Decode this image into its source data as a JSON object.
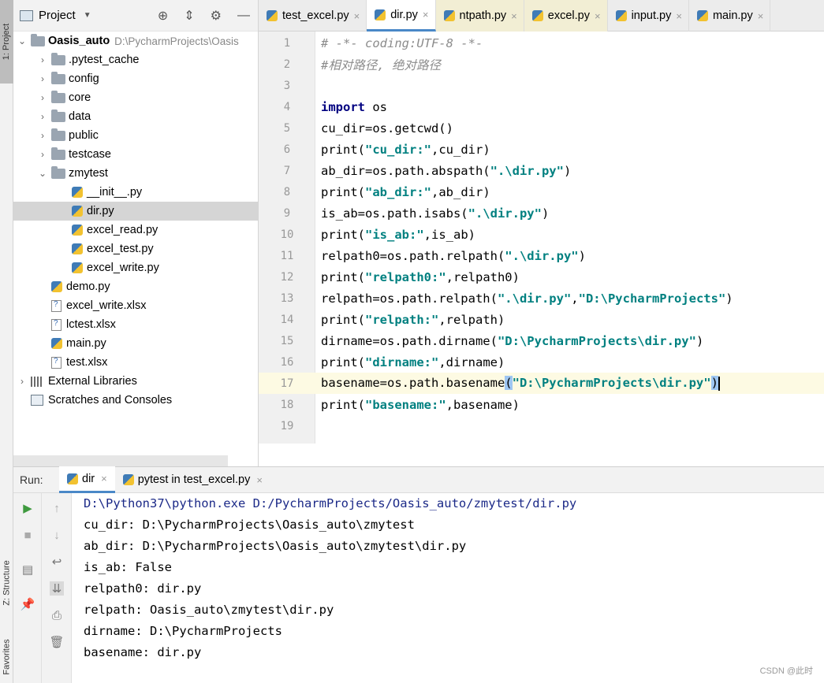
{
  "tool_strip": {
    "project": "1: Project",
    "structure": "Z: Structure",
    "favorites": "Favorites"
  },
  "project_panel": {
    "title": "Project",
    "tree": [
      {
        "label": "Oasis_auto",
        "path": "D:\\PycharmProjects\\Oasis",
        "depth": 0,
        "kind": "folder",
        "arrow": "v",
        "bold": true
      },
      {
        "label": ".pytest_cache",
        "depth": 1,
        "kind": "folder",
        "arrow": ">"
      },
      {
        "label": "config",
        "depth": 1,
        "kind": "folder",
        "arrow": ">"
      },
      {
        "label": "core",
        "depth": 1,
        "kind": "folder",
        "arrow": ">"
      },
      {
        "label": "data",
        "depth": 1,
        "kind": "folder",
        "arrow": ">"
      },
      {
        "label": "public",
        "depth": 1,
        "kind": "folder",
        "arrow": ">"
      },
      {
        "label": "testcase",
        "depth": 1,
        "kind": "folder",
        "arrow": ">"
      },
      {
        "label": "zmytest",
        "depth": 1,
        "kind": "folder",
        "arrow": "v"
      },
      {
        "label": "__init__.py",
        "depth": 2,
        "kind": "py"
      },
      {
        "label": "dir.py",
        "depth": 2,
        "kind": "py",
        "selected": true
      },
      {
        "label": "excel_read.py",
        "depth": 2,
        "kind": "py"
      },
      {
        "label": "excel_test.py",
        "depth": 2,
        "kind": "py"
      },
      {
        "label": "excel_write.py",
        "depth": 2,
        "kind": "py"
      },
      {
        "label": "demo.py",
        "depth": 1,
        "kind": "py"
      },
      {
        "label": "excel_write.xlsx",
        "depth": 1,
        "kind": "xlsx"
      },
      {
        "label": "lctest.xlsx",
        "depth": 1,
        "kind": "xlsx"
      },
      {
        "label": "main.py",
        "depth": 1,
        "kind": "py"
      },
      {
        "label": "test.xlsx",
        "depth": 1,
        "kind": "xlsx"
      },
      {
        "label": "External Libraries",
        "depth": 0,
        "kind": "lib",
        "arrow": ">"
      },
      {
        "label": "Scratches and Consoles",
        "depth": 0,
        "kind": "scratch"
      }
    ]
  },
  "editor_tabs": [
    {
      "label": "test_excel.py",
      "style": "normal"
    },
    {
      "label": "dir.py",
      "style": "active"
    },
    {
      "label": "ntpath.py",
      "style": "yellow"
    },
    {
      "label": "excel.py",
      "style": "yellow"
    },
    {
      "label": "input.py",
      "style": "normal"
    },
    {
      "label": "main.py",
      "style": "normal"
    }
  ],
  "editor": {
    "current_line": 17,
    "lines": [
      {
        "n": "1",
        "parts": [
          {
            "t": "# -*- coding:UTF-8 -*-",
            "c": "cmt"
          }
        ]
      },
      {
        "n": "2",
        "parts": [
          {
            "t": "#相对路径, 绝对路径",
            "c": "cmt"
          }
        ]
      },
      {
        "n": "3",
        "parts": []
      },
      {
        "n": "4",
        "parts": [
          {
            "t": "import",
            "c": "kw"
          },
          {
            "t": " os",
            "c": ""
          }
        ]
      },
      {
        "n": "5",
        "parts": [
          {
            "t": "cu_dir=os.getcwd()",
            "c": ""
          }
        ]
      },
      {
        "n": "6",
        "parts": [
          {
            "t": "print(",
            "c": ""
          },
          {
            "t": "\"cu_dir:\"",
            "c": "str"
          },
          {
            "t": ",cu_dir)",
            "c": ""
          }
        ]
      },
      {
        "n": "7",
        "parts": [
          {
            "t": "ab_dir=os.path.abspath(",
            "c": ""
          },
          {
            "t": "\".\\dir.py\"",
            "c": "str"
          },
          {
            "t": ")",
            "c": ""
          }
        ]
      },
      {
        "n": "8",
        "parts": [
          {
            "t": "print(",
            "c": ""
          },
          {
            "t": "\"ab_dir:\"",
            "c": "str"
          },
          {
            "t": ",ab_dir)",
            "c": ""
          }
        ]
      },
      {
        "n": "9",
        "parts": [
          {
            "t": "is_ab=os.path.isabs(",
            "c": ""
          },
          {
            "t": "\".\\dir.py\"",
            "c": "str"
          },
          {
            "t": ")",
            "c": ""
          }
        ]
      },
      {
        "n": "10",
        "parts": [
          {
            "t": "print(",
            "c": ""
          },
          {
            "t": "\"is_ab:\"",
            "c": "str"
          },
          {
            "t": ",is_ab)",
            "c": ""
          }
        ]
      },
      {
        "n": "11",
        "parts": [
          {
            "t": "relpath0=os.path.relpath(",
            "c": ""
          },
          {
            "t": "\".\\dir.py\"",
            "c": "str"
          },
          {
            "t": ")",
            "c": ""
          }
        ]
      },
      {
        "n": "12",
        "parts": [
          {
            "t": "print(",
            "c": ""
          },
          {
            "t": "\"relpath0:\"",
            "c": "str"
          },
          {
            "t": ",relpath0)",
            "c": ""
          }
        ]
      },
      {
        "n": "13",
        "parts": [
          {
            "t": "relpath=os.path.relpath(",
            "c": ""
          },
          {
            "t": "\".\\dir.py\"",
            "c": "str"
          },
          {
            "t": ",",
            "c": ""
          },
          {
            "t": "\"D:\\PycharmProjects\"",
            "c": "str"
          },
          {
            "t": ")",
            "c": ""
          }
        ]
      },
      {
        "n": "14",
        "parts": [
          {
            "t": "print(",
            "c": ""
          },
          {
            "t": "\"relpath:\"",
            "c": "str"
          },
          {
            "t": ",relpath)",
            "c": ""
          }
        ]
      },
      {
        "n": "15",
        "parts": [
          {
            "t": "dirname=os.path.dirname(",
            "c": ""
          },
          {
            "t": "\"D:\\PycharmProjects\\dir.py\"",
            "c": "str"
          },
          {
            "t": ")",
            "c": ""
          }
        ]
      },
      {
        "n": "16",
        "parts": [
          {
            "t": "print(",
            "c": ""
          },
          {
            "t": "\"dirname:\"",
            "c": "str"
          },
          {
            "t": ",dirname)",
            "c": ""
          }
        ]
      },
      {
        "n": "17",
        "parts": [
          {
            "t": "basename=os.path.basename",
            "c": ""
          },
          {
            "t": "(",
            "c": "brace"
          },
          {
            "t": "\"D:\\PycharmProjects\\dir.py\"",
            "c": "str"
          },
          {
            "t": ")",
            "c": "brace"
          }
        ]
      },
      {
        "n": "18",
        "parts": [
          {
            "t": "print(",
            "c": ""
          },
          {
            "t": "\"basename:\"",
            "c": "str"
          },
          {
            "t": ",basename)",
            "c": ""
          }
        ]
      },
      {
        "n": "19",
        "parts": []
      }
    ]
  },
  "run_panel": {
    "label": "Run:",
    "tabs": [
      {
        "label": "dir",
        "active": true
      },
      {
        "label": "pytest in test_excel.py",
        "active": false
      }
    ],
    "output": [
      "D:\\Python37\\python.exe D:/PycharmProjects/Oasis_auto/zmytest/dir.py",
      "cu_dir: D:\\PycharmProjects\\Oasis_auto\\zmytest",
      "ab_dir: D:\\PycharmProjects\\Oasis_auto\\zmytest\\dir.py",
      "is_ab: False",
      "relpath0: dir.py",
      "relpath: Oasis_auto\\zmytest\\dir.py",
      "dirname: D:\\PycharmProjects",
      "basename: dir.py"
    ]
  },
  "watermark": "CSDN @此时"
}
